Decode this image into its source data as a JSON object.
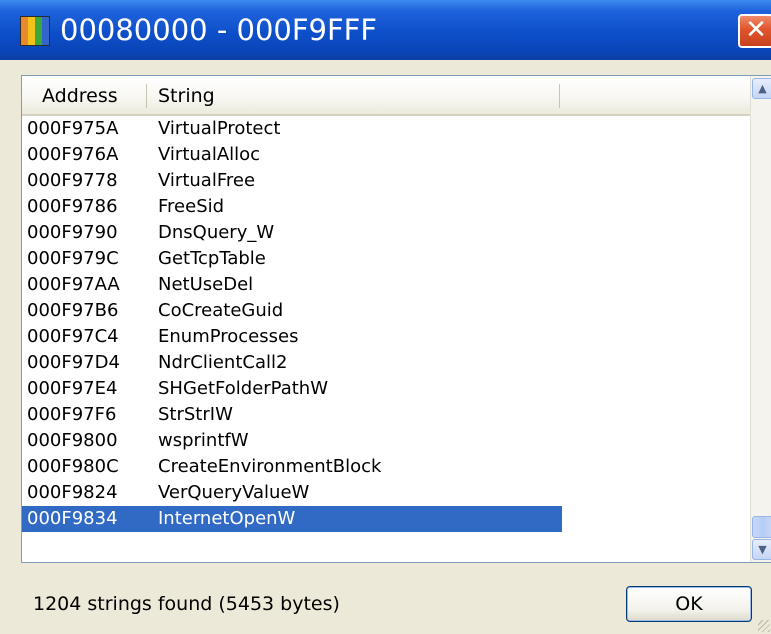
{
  "window": {
    "title": "00080000 - 000F9FFF",
    "close_glyph": "✕",
    "icon_colors": [
      "#e8892c",
      "#f2c21a",
      "#3aa83a",
      "#3366cc"
    ]
  },
  "list": {
    "columns": [
      "Address",
      "String"
    ],
    "rows": [
      {
        "address": "000F975A",
        "string": "VirtualProtect"
      },
      {
        "address": "000F976A",
        "string": "VirtualAlloc"
      },
      {
        "address": "000F9778",
        "string": "VirtualFree"
      },
      {
        "address": "000F9786",
        "string": "FreeSid"
      },
      {
        "address": "000F9790",
        "string": "DnsQuery_W"
      },
      {
        "address": "000F979C",
        "string": "GetTcpTable"
      },
      {
        "address": "000F97AA",
        "string": "NetUseDel"
      },
      {
        "address": "000F97B6",
        "string": "CoCreateGuid"
      },
      {
        "address": "000F97C4",
        "string": "EnumProcesses"
      },
      {
        "address": "000F97D4",
        "string": "NdrClientCall2"
      },
      {
        "address": "000F97E4",
        "string": "SHGetFolderPathW"
      },
      {
        "address": "000F97F6",
        "string": "StrStrIW"
      },
      {
        "address": "000F9800",
        "string": "wsprintfW"
      },
      {
        "address": "000F980C",
        "string": "CreateEnvironmentBlock"
      },
      {
        "address": "000F9824",
        "string": "VerQueryValueW"
      },
      {
        "address": "000F9834",
        "string": "InternetOpenW"
      }
    ],
    "selected_index": 15,
    "scroll_up_glyph": "▲",
    "scroll_down_glyph": "▼",
    "selection_color": "#316ac5"
  },
  "status": {
    "text": "1204 strings found (5453 bytes)"
  },
  "buttons": {
    "ok_label": "OK"
  }
}
